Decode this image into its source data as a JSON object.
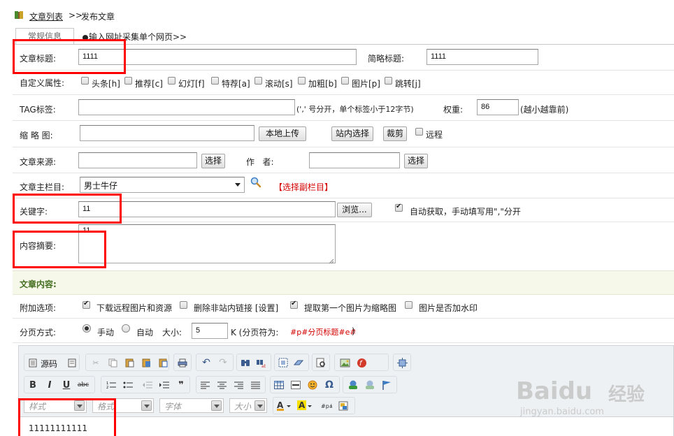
{
  "breadcrumb": {
    "list_link": "文章列表",
    "sep": ">>",
    "current": "发布文章"
  },
  "tabs": {
    "general": "常规信息",
    "import": "输入网址采集单个网页>>"
  },
  "form": {
    "title_label": "文章标题:",
    "title_value": "1111",
    "short_title_label": "简略标题:",
    "short_title_value": "1111",
    "attr_label": "自定义属性:",
    "attrs": [
      "头条[h]",
      "推荐[c]",
      "幻灯[f]",
      "特荐[a]",
      "滚动[s]",
      "加粗[b]",
      "图片[p]",
      "跳转[j]"
    ],
    "tag_label": "TAG标签:",
    "tag_hint": "(',' 号分开，单个标签小于12字节)",
    "weight_label": "权重:",
    "weight_value": "86",
    "weight_hint": "(越小越靠前)",
    "thumb_label": "缩 略 图:",
    "upload_btn": "本地上传",
    "site_select_btn": "站内选择",
    "crop_btn": "裁剪",
    "remote_label": "远程",
    "source_label": "文章来源:",
    "select_btn": "选择",
    "author_label": "作   者:",
    "author_select_btn": "选择",
    "column_label": "文章主栏目:",
    "column_value": "男士牛仔",
    "sub_column_link": "【选择副栏目】",
    "keyword_label": "关键字:",
    "keyword_value": "11",
    "browse_btn": "浏览...",
    "auto_keyword_label": "自动获取，手动填写用\",\"分开",
    "summary_label": "内容摘要:",
    "summary_value": "11",
    "content_section": "文章内容:",
    "extra_label": "附加选项:",
    "extras": [
      "下载远程图片和资源",
      "删除非站内链接 [设置]",
      "提取第一个图片为缩略图",
      "图片是否加水印"
    ],
    "paging_label": "分页方式:",
    "paging_manual": "手动",
    "paging_auto": "自动",
    "size_label": "大小:",
    "size_value": "5",
    "size_unit_hint": "K (分页符为:",
    "paging_symbol": "#p#分页标题#e#",
    "paging_hint_close": ")"
  },
  "editor": {
    "source_btn": "源码",
    "style_combo": "样式",
    "format_combo": "格式",
    "font_combo": "字体",
    "size_combo": "大小",
    "content_text": "11111111111"
  },
  "watermark": {
    "brand": "Baidu",
    "brand_cn": "经验",
    "url": "jingyan.baidu.com"
  }
}
